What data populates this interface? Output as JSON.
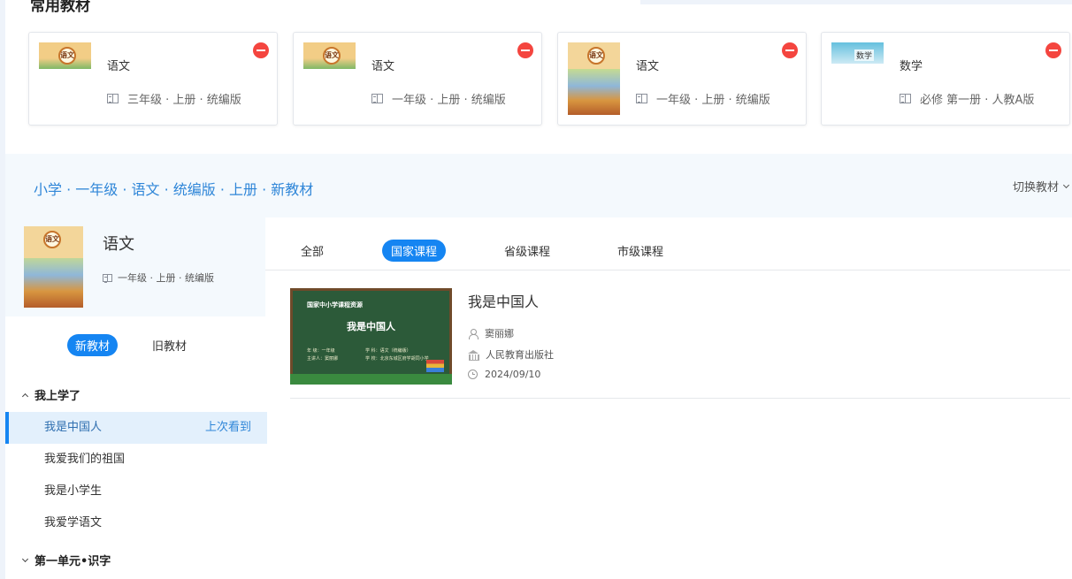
{
  "section": {
    "title": "常用教材"
  },
  "common_books": [
    {
      "name": "语文",
      "meta": "三年级 · 上册 · 统编版",
      "cover_tag": "语文"
    },
    {
      "name": "语文",
      "meta": "一年级 · 上册 · 统编版",
      "cover_tag": "语文"
    },
    {
      "name": "语文",
      "meta": "一年级 · 上册 · 统编版",
      "cover_tag": "语文"
    },
    {
      "name": "数学",
      "meta": "必修 第一册 · 人教A版",
      "cover_tag": "数学"
    }
  ],
  "breadcrumb": {
    "path": "小学 · 一年级 · 语文 · 统编版 · 上册 · 新教材"
  },
  "switch": {
    "label": "切换教材"
  },
  "current_book": {
    "name": "语文",
    "meta": "一年级 · 上册 · 统编版"
  },
  "edition": {
    "new_label": "新教材",
    "old_label": "旧教材"
  },
  "units": [
    {
      "title": "我上学了",
      "expanded": true,
      "lessons": [
        {
          "label": "我是中国人",
          "active": true,
          "badge": "上次看到"
        },
        {
          "label": "我爱我们的祖国"
        },
        {
          "label": "我是小学生"
        },
        {
          "label": "我爱学语文"
        }
      ]
    },
    {
      "title": "第一单元•识字",
      "expanded": false
    }
  ],
  "tabs": [
    {
      "label": "全部"
    },
    {
      "label": "国家课程",
      "active": true
    },
    {
      "label": "省级课程"
    },
    {
      "label": "市级课程"
    }
  ],
  "course": {
    "title": "我是中国人",
    "teacher": "窦丽娜",
    "publisher": "人民教育出版社",
    "date": "2024/09/10",
    "thumb": {
      "header": "国家中小学课程资源",
      "title": "我是中国人",
      "grade_line": "年  级：一年级",
      "teacher_line": "主讲人：窦丽娜",
      "subject_line": "学  科：语文（统编版）",
      "school_line": "学  校：北京东城区府学胡同小学"
    }
  },
  "colors": {
    "accent": "#1585f2",
    "link": "#2f86d8",
    "remove": "#f4453f",
    "panel_bg": "#f4f9fd"
  }
}
